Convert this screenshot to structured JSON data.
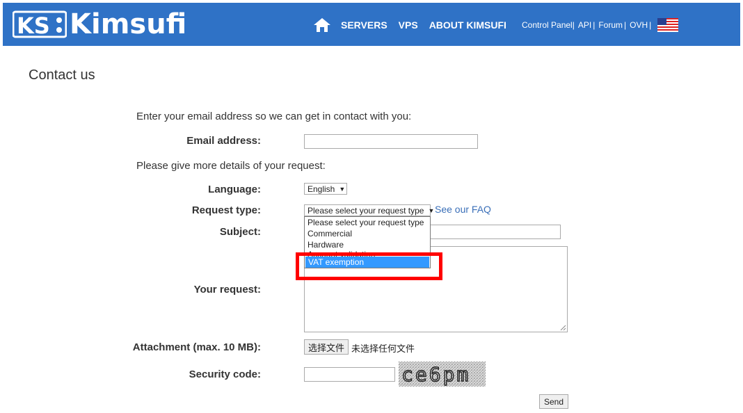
{
  "header": {
    "logo_text": "Kimsufi",
    "nav": [
      "SERVERS",
      "VPS",
      "ABOUT KIMSUFI"
    ],
    "top_links": [
      "Control Panel",
      "API",
      "Forum",
      "OVH"
    ],
    "separator": "|",
    "bg_color": "#2f72c6"
  },
  "page": {
    "title": "Contact us",
    "intro_email": "Enter your email address so we can get in contact with you:",
    "intro_details": "Please give more details of your request:"
  },
  "form": {
    "email_label": "Email address:",
    "email_value": "",
    "language_label": "Language:",
    "language_value": "English",
    "request_type_label": "Request type:",
    "request_type_value": "Please select your request type",
    "faq_link": "See our FAQ",
    "request_type_options": [
      "Please select your request type",
      "Commercial",
      "Hardware",
      "Account validation",
      "VAT exemption"
    ],
    "selected_option_index": 4,
    "subject_label": "Subject:",
    "subject_value": "",
    "your_request_label": "Your request:",
    "attachment_label": "Attachment (max. 10 MB):",
    "file_button": "选择文件",
    "file_status": "未选择任何文件",
    "security_label": "Security code:",
    "security_value": "",
    "captcha_text": "ce6pm",
    "send_button": "Send"
  },
  "icons": {
    "home": "home-icon",
    "flag": "us-flag-icon"
  },
  "highlight_color": "#ff0000"
}
